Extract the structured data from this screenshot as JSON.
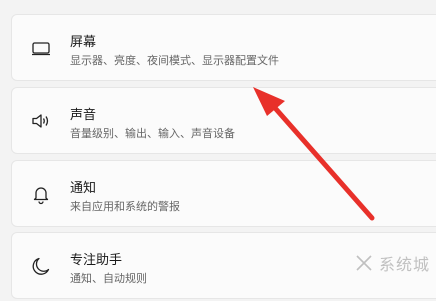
{
  "settings": {
    "items": [
      {
        "title": "屏幕",
        "subtitle": "显示器、亮度、夜间模式、显示器配置文件",
        "icon": "monitor-icon"
      },
      {
        "title": "声音",
        "subtitle": "音量级别、输出、输入、声音设备",
        "icon": "speaker-icon"
      },
      {
        "title": "通知",
        "subtitle": "来自应用和系统的警报",
        "icon": "bell-icon"
      },
      {
        "title": "专注助手",
        "subtitle": "通知、自动规则",
        "icon": "moon-icon"
      }
    ]
  },
  "annotation": {
    "icon": "red-arrow-icon",
    "color": "#e8302a"
  },
  "watermark": {
    "text": "系统城"
  }
}
